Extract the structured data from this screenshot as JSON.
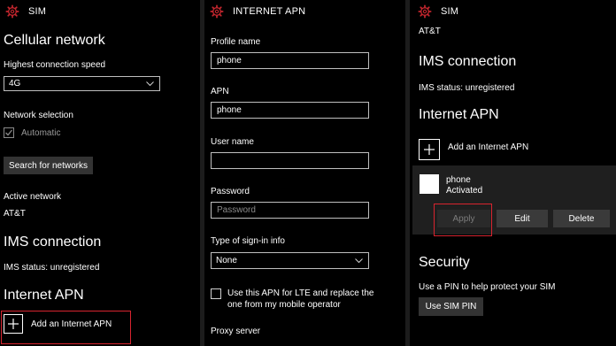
{
  "panel1": {
    "header_title": "SIM",
    "cellular_title": "Cellular network",
    "speed_label": "Highest connection speed",
    "speed_value": "4G",
    "network_selection_label": "Network selection",
    "automatic_label": "Automatic",
    "search_button": "Search for networks",
    "active_network_label": "Active network",
    "active_network_value": "AT&T",
    "ims_title": "IMS connection",
    "ims_status": "IMS status: unregistered",
    "apn_title": "Internet APN",
    "add_apn": "Add an Internet APN"
  },
  "panel2": {
    "header_title": "INTERNET APN",
    "profile_name_label": "Profile name",
    "profile_name_value": "phone",
    "apn_label": "APN",
    "apn_value": "phone",
    "user_name_label": "User name",
    "user_name_value": "",
    "password_label": "Password",
    "password_placeholder": "Password",
    "signin_label": "Type of sign-in info",
    "signin_value": "None",
    "lte_checkbox_line1": "Use this APN for LTE and replace the",
    "lte_checkbox_line2": "one from my mobile operator",
    "proxy_label": "Proxy server"
  },
  "panel3": {
    "header_title": "SIM",
    "carrier": "AT&T",
    "ims_title": "IMS connection",
    "ims_status": "IMS status: unregistered",
    "apn_title": "Internet APN",
    "add_apn": "Add an Internet APN",
    "profile_name": "phone",
    "profile_status": "Activated",
    "apply_button": "Apply",
    "edit_button": "Edit",
    "delete_button": "Delete",
    "security_title": "Security",
    "pin_text": "Use a PIN to help protect your SIM",
    "use_pin_button": "Use SIM PIN"
  },
  "colors": {
    "accent_red": "#d8242f",
    "gear": "#c4262e",
    "background": "#000000"
  }
}
